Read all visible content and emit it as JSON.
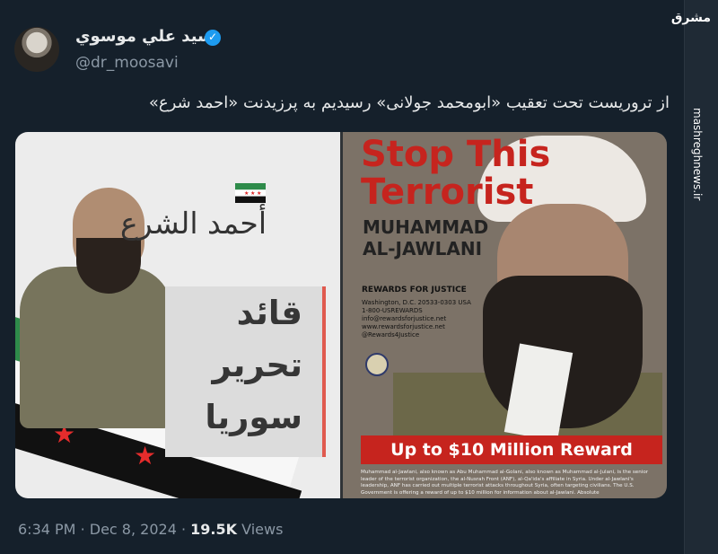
{
  "tweet": {
    "display_name": "سيد علي موسوي",
    "handle": "@dr_moosavi",
    "text": "از تروریست تحت تعقیب «ابومحمد جولانی» رسیدیم به پرزیدنت «احمد شرع»",
    "time": "6:34 PM",
    "date": "Dec 8, 2024",
    "views": "19.5K",
    "views_label": "Views",
    "separator": "·"
  },
  "media": {
    "left": {
      "name_calligraphy": "أحمد الشرع",
      "headline_lines": [
        "قائد",
        "تحرير",
        "سوريا"
      ]
    },
    "right": {
      "title_lines": [
        "Stop This",
        "Terrorist"
      ],
      "name_lines": [
        "MUHAMMAD",
        "AL-JAWLANI"
      ],
      "rfj_title": "REWARDS FOR JUSTICE",
      "rfj_lines": [
        "Washington, D.C. 20533-0303 USA",
        "1-800-USREWARDS",
        "info@rewardsforjustice.net",
        "www.rewardsforjustice.net",
        "@Rewards4Justice"
      ],
      "reward": "Up to $10 Million Reward",
      "fine_print": "Muhammad al-Jawlani, also known as Abu Muhammad al-Golani, also known as Muhammad al-Julani, is the senior leader of the terrorist organization, the al-Nusrah Front (ANF), al-Qa'ida's affiliate in Syria. Under al-Jawlani's leadership, ANF has carried out multiple terrorist attacks throughout Syria, often targeting civilians. The U.S. Government is offering a reward of up to $10 million for information about al-Jawlani. Absolute"
    }
  },
  "watermark": {
    "logo_text": "مشرق",
    "site": "mashreghnews.ir"
  },
  "colors": {
    "background": "#15202b",
    "primary_text": "#e7e9ea",
    "secondary_text": "#8b98a5",
    "verified": "#1d9bf0",
    "poster_red": "#c6241e"
  },
  "icons": [
    "verified-badge-icon"
  ]
}
